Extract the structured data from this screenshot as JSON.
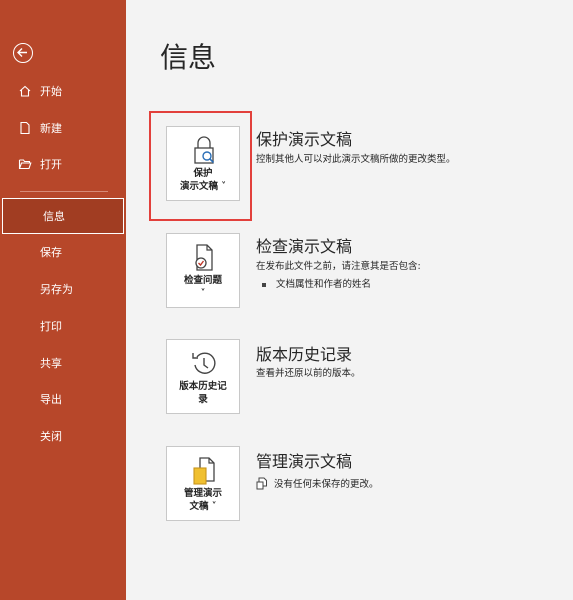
{
  "sidebar": {
    "items": [
      {
        "label": "开始",
        "icon": "home-icon"
      },
      {
        "label": "新建",
        "icon": "new-file-icon"
      },
      {
        "label": "打开",
        "icon": "open-folder-icon"
      },
      {
        "label": "信息",
        "active": true
      },
      {
        "label": "保存"
      },
      {
        "label": "另存为"
      },
      {
        "label": "打印"
      },
      {
        "label": "共享"
      },
      {
        "label": "导出"
      },
      {
        "label": "关闭"
      }
    ]
  },
  "page": {
    "title": "信息"
  },
  "sections": [
    {
      "button_line1": "保护",
      "button_line2": "演示文稿 ˅",
      "title": "保护演示文稿",
      "desc": "控制其他人可以对此演示文稿所做的更改类型。",
      "icon": "lock-search-icon"
    },
    {
      "button_line1": "检查问题",
      "button_line2": "˅",
      "title": "检查演示文稿",
      "desc": "在发布此文件之前，请注意其是否包含:",
      "bullet": "文档属性和作者的姓名",
      "icon": "check-doc-icon"
    },
    {
      "button_line1": "版本历史记",
      "button_line2": "录",
      "title": "版本历史记录",
      "desc": "查看并还原以前的版本。",
      "icon": "history-icon"
    },
    {
      "button_line1": "管理演示",
      "button_line2": "文稿 ˅",
      "title": "管理演示文稿",
      "desc": "没有任何未保存的更改。",
      "icon": "manage-doc-icon"
    }
  ],
  "colors": {
    "sidebar": "#b7472a",
    "highlight": "#e2403b"
  }
}
